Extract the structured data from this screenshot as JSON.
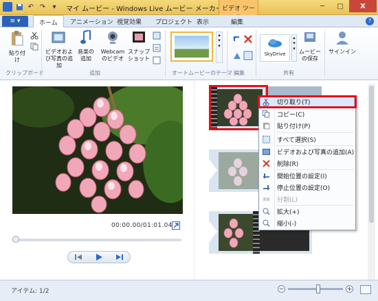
{
  "titlebar": {
    "title": "マイ ムービー - Windows Live ムービー メーカー",
    "context_tab_group": "ビデオ ツール",
    "minimize": "─",
    "maximize": "□",
    "close": "X"
  },
  "tabs": {
    "file": "",
    "items": [
      "ホーム",
      "アニメーション",
      "視覚効果",
      "プロジェクト",
      "表示",
      "編集"
    ]
  },
  "help": "?",
  "ribbon": {
    "paste": "貼り付け",
    "clipboard_group": "クリップボード",
    "add_video_photos": "ビデオおよび写真の追加",
    "add_music": "音楽の追加",
    "webcam_video": "Webcam のビデオ",
    "snapshot": "スナップショット",
    "add_group": "追加",
    "automovie_group": "オートムービーのテーマ",
    "edit_group": "編集",
    "skydrive": "SkyDrive",
    "save_movie": "ムービーの保存",
    "share_group": "共有",
    "sign_in": "サインイン"
  },
  "preview": {
    "time": "00:00.00/01:01.04"
  },
  "context_menu": {
    "items": [
      {
        "label": "切り取り(T)",
        "icon": "scissors-icon",
        "enabled": true
      },
      {
        "label": "コピー(C)",
        "icon": "copy-icon",
        "enabled": true
      },
      {
        "label": "貼り付け(P)",
        "icon": "paste-icon",
        "enabled": true
      },
      {
        "label": "すべて選択(S)",
        "icon": "select-all-icon",
        "enabled": true
      },
      {
        "label": "ビデオおよび写真の追加(A)",
        "icon": "add-media-icon",
        "enabled": true
      },
      {
        "label": "削除(R)",
        "icon": "delete-icon",
        "enabled": true
      },
      {
        "label": "開始位置の設定(I)",
        "icon": "set-start-icon",
        "enabled": true
      },
      {
        "label": "停止位置の設定(O)",
        "icon": "set-end-icon",
        "enabled": true
      },
      {
        "label": "分割(L)",
        "icon": "split-icon",
        "enabled": false
      },
      {
        "label": "拡大(+)",
        "icon": "zoom-in-icon",
        "enabled": true
      },
      {
        "label": "縮小(-)",
        "icon": "zoom-out-icon",
        "enabled": true
      }
    ]
  },
  "status": {
    "items": "アイテム: 1/2",
    "zoom_level": 0.55
  },
  "colors": {
    "titlebar": "#e9c25a",
    "accent": "#2f68c8",
    "highlight_border": "#e0101a"
  }
}
